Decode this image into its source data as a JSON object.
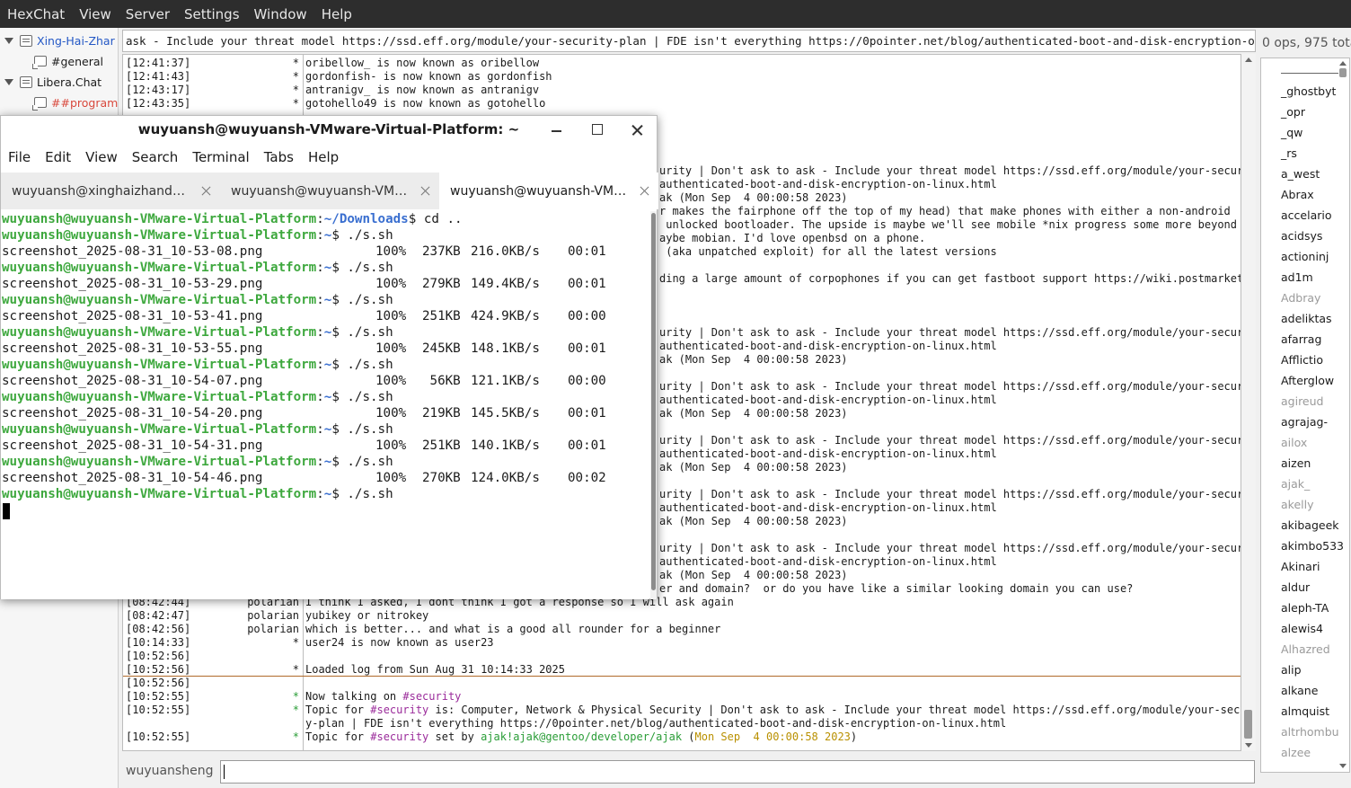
{
  "hexchat": {
    "menu": [
      "HexChat",
      "View",
      "Server",
      "Settings",
      "Window",
      "Help"
    ],
    "tree": {
      "server1": "Xing-Hai-Zhar",
      "server1_channel": "#general",
      "server2": "Libera.Chat",
      "server2_channel": "##programm"
    },
    "topic": "ask - Include your threat model https://ssd.eff.org/module/your-security-plan | FDE isn't everything https://0pointer.net/blog/authenticated-boot-and-disk-encryption-on-linux.html",
    "ops_info": "0 ops, 975 tota",
    "chat_top": [
      {
        "ts": "[12:41:37]",
        "nick": "*",
        "msg": "oribellow_ is now known as oribellow"
      },
      {
        "ts": "[12:41:43]",
        "nick": "*",
        "msg": "gordonfish- is now known as gordonfish"
      },
      {
        "ts": "[12:43:17]",
        "nick": "*",
        "msg": "antranigv_ is now known as antranigv"
      },
      {
        "ts": "[12:43:35]",
        "nick": "*",
        "msg": "gotohello49 is now known as gotohello"
      }
    ],
    "chat_right_fragments": [
      "urity | Don't ask to ask - Include your threat model https://ssd.eff.org/module/your-securit",
      "authenticated-boot-and-disk-encryption-on-linux.html",
      "ak (Mon Sep  4 00:00:58 2023)",
      "r makes the fairphone off the top of my head) that make phones with either a non-android",
      " unlocked bootloader. The upside is maybe we'll see mobile *nix progress some more beyond",
      "aybe mobian. I'd love openbsd on a phone.",
      " (aka unpatched exploit) for all the latest versions",
      "ding a large amount of corpophones if you can get fastboot support https://wiki.postmarketos",
      "urity | Don't ask to ask - Include your threat model https://ssd.eff.org/module/your-securit",
      "authenticated-boot-and-disk-encryption-on-linux.html",
      "ak (Mon Sep  4 00:00:58 2023)",
      "urity | Don't ask to ask - Include your threat model https://ssd.eff.org/module/your-securit",
      "authenticated-boot-and-disk-encryption-on-linux.html",
      "ak (Mon Sep  4 00:00:58 2023)",
      "urity | Don't ask to ask - Include your threat model https://ssd.eff.org/module/your-securit",
      "authenticated-boot-and-disk-encryption-on-linux.html",
      "ak (Mon Sep  4 00:00:58 2023)",
      "urity | Don't ask to ask - Include your threat model https://ssd.eff.org/module/your-securit",
      "authenticated-boot-and-disk-encryption-on-linux.html",
      "ak (Mon Sep  4 00:00:58 2023)",
      "urity | Don't ask to ask - Include your threat model https://ssd.eff.org/module/your-securit",
      "authenticated-boot-and-disk-encryption-on-linux.html",
      "ak (Mon Sep  4 00:00:58 2023)",
      "er and domain?  or do you have like a similar looking domain you can use?"
    ],
    "chat_bottom": [
      {
        "ts": "[08:42:44]",
        "nick": "polarian",
        "msg": "I think I asked, I dont think I got a response so I will ask again"
      },
      {
        "ts": "[08:42:47]",
        "nick": "polarian",
        "msg": "yubikey or nitrokey"
      },
      {
        "ts": "[08:42:56]",
        "nick": "polarian",
        "msg": "which is better... and what is a good all rounder for a beginner"
      },
      {
        "ts": "[10:14:33]",
        "nick": "*",
        "msg": "user24 is now known as user23"
      },
      {
        "ts": "[10:52:56]",
        "nick": "",
        "msg": ""
      },
      {
        "ts": "[10:52:56]",
        "nick": "*",
        "msg": "Loaded log from Sun Aug 31 10:14:33 2025"
      },
      {
        "ts": "[10:52:56]",
        "nick": "",
        "msg": ""
      }
    ],
    "now_talking": {
      "ts": "[10:52:55]",
      "nick": "*",
      "prefix": "Now talking on ",
      "channel": "#security"
    },
    "topic_msg": {
      "ts": "[10:52:55]",
      "nick": "*",
      "prefix": "Topic for ",
      "channel": "#security",
      "text1": " is: Computer, Network & Physical Security | Don't ask to ask - Include your threat model https://ssd.eff.org/module/your-securit",
      "text2": "y-plan | FDE isn't everything https://0pointer.net/blog/authenticated-boot-and-disk-encryption-on-linux.html"
    },
    "topic_set": {
      "ts": "[10:52:55]",
      "nick": "*",
      "prefix": "Topic for ",
      "channel": "#security",
      "mid": " set by ",
      "setter": "ajak!ajak@gentoo/developer/ajak",
      "open": " (",
      "date": "Mon Sep  4 00:00:58 2023",
      "close": ")"
    },
    "users": [
      {
        "name": "_ghostbyt",
        "away": false
      },
      {
        "name": "_opr",
        "away": false
      },
      {
        "name": "_qw",
        "away": false
      },
      {
        "name": "_rs",
        "away": false
      },
      {
        "name": "a_west",
        "away": false
      },
      {
        "name": "Abrax",
        "away": false
      },
      {
        "name": "accelario",
        "away": false
      },
      {
        "name": "acidsys",
        "away": false
      },
      {
        "name": "actioninj",
        "away": false
      },
      {
        "name": "ad1m",
        "away": false
      },
      {
        "name": "Adbray",
        "away": true
      },
      {
        "name": "adeliktas",
        "away": false
      },
      {
        "name": "afarrag",
        "away": false
      },
      {
        "name": "Afflictio",
        "away": false
      },
      {
        "name": "Afterglow",
        "away": false
      },
      {
        "name": "agireud",
        "away": true
      },
      {
        "name": "agrajag-",
        "away": false
      },
      {
        "name": "ailox",
        "away": true
      },
      {
        "name": "aizen",
        "away": false
      },
      {
        "name": "ajak_",
        "away": true
      },
      {
        "name": "akelly",
        "away": true
      },
      {
        "name": "akibageek",
        "away": false
      },
      {
        "name": "akimbo533",
        "away": false
      },
      {
        "name": "Akinari",
        "away": false
      },
      {
        "name": "aldur",
        "away": false
      },
      {
        "name": "aleph-TA",
        "away": false
      },
      {
        "name": "alewis4",
        "away": false
      },
      {
        "name": "Alhazred",
        "away": true
      },
      {
        "name": "alip",
        "away": false
      },
      {
        "name": "alkane",
        "away": false
      },
      {
        "name": "almquist",
        "away": false
      },
      {
        "name": "altrhombu",
        "away": true
      },
      {
        "name": "alzee",
        "away": true
      }
    ],
    "input_nick": "wuyuansheng",
    "input_value": ""
  },
  "terminal": {
    "title": "wuyuansh@wuyuansh-VMware-Virtual-Platform: ~",
    "menu": [
      "File",
      "Edit",
      "View",
      "Search",
      "Terminal",
      "Tabs",
      "Help"
    ],
    "tabs": [
      {
        "label": "wuyuansh@xinghaizhand…",
        "active": false
      },
      {
        "label": "wuyuansh@wuyuansh-VM…",
        "active": false
      },
      {
        "label": "wuyuansh@wuyuansh-VM…",
        "active": true
      }
    ],
    "prompt_user": "wuyuansh@wuyuansh-VMware-Virtual-Platform",
    "first": {
      "path": "~/Downloads",
      "cmd": "$ cd .."
    },
    "transfers": [
      {
        "file": "screenshot_2025-08-31_10-53-08.png",
        "pct": "100%",
        "size": "237KB",
        "rate": "216.0KB/s",
        "time": "00:01"
      },
      {
        "file": "screenshot_2025-08-31_10-53-29.png",
        "pct": "100%",
        "size": "279KB",
        "rate": "149.4KB/s",
        "time": "00:01"
      },
      {
        "file": "screenshot_2025-08-31_10-53-41.png",
        "pct": "100%",
        "size": "251KB",
        "rate": "424.9KB/s",
        "time": "00:00"
      },
      {
        "file": "screenshot_2025-08-31_10-53-55.png",
        "pct": "100%",
        "size": "245KB",
        "rate": "148.1KB/s",
        "time": "00:01"
      },
      {
        "file": "screenshot_2025-08-31_10-54-07.png",
        "pct": "100%",
        "size": " 56KB",
        "rate": "121.1KB/s",
        "time": "00:00"
      },
      {
        "file": "screenshot_2025-08-31_10-54-20.png",
        "pct": "100%",
        "size": "219KB",
        "rate": "145.5KB/s",
        "time": "00:01"
      },
      {
        "file": "screenshot_2025-08-31_10-54-31.png",
        "pct": "100%",
        "size": "251KB",
        "rate": "140.1KB/s",
        "time": "00:01"
      },
      {
        "file": "screenshot_2025-08-31_10-54-46.png",
        "pct": "100%",
        "size": "270KB",
        "rate": "124.0KB/s",
        "time": "00:02"
      }
    ],
    "home_path": "~",
    "repeat_cmd": "$ ./s.sh"
  },
  "colors": {
    "prompt_user": "#3ea83e",
    "prompt_path": "#3a6fd0",
    "channel": "#9b2c9b",
    "marker_line": "#b06a2a"
  }
}
